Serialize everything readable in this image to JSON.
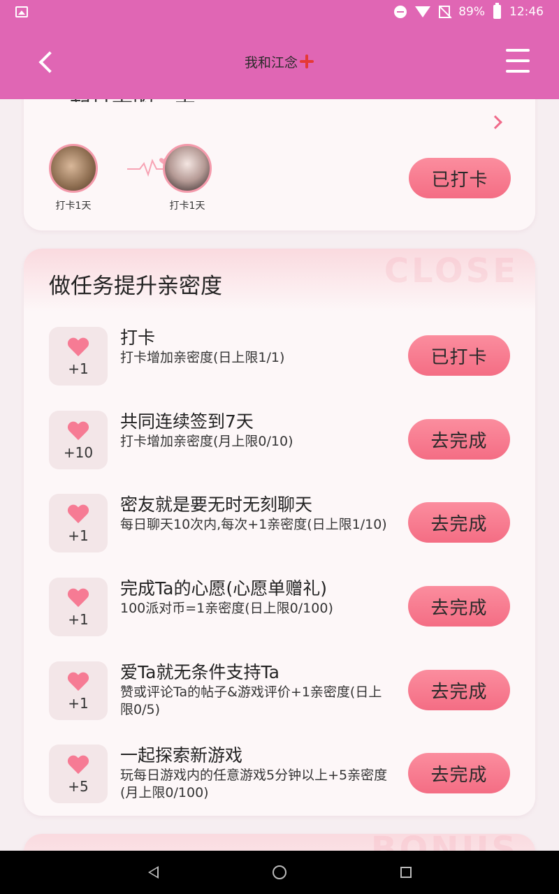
{
  "status_bar": {
    "battery": "89%",
    "time": "12:46"
  },
  "header": {
    "title": "我和江念"
  },
  "checkin": {
    "partial_title": "一起打卡的一天",
    "users": [
      {
        "label": "打卡1天"
      },
      {
        "label": "打卡1天"
      }
    ],
    "button_label": "已打卡"
  },
  "tasks_section": {
    "title": "做任务提升亲密度",
    "watermark": "CLOSE",
    "tasks": [
      {
        "points": "+1",
        "name": "打卡",
        "desc": "打卡增加亲密度(日上限1/1)",
        "button": "已打卡"
      },
      {
        "points": "+10",
        "name": "共同连续签到7天",
        "desc": "打卡增加亲密度(月上限0/10)",
        "button": "去完成"
      },
      {
        "points": "+1",
        "name": "密友就是要无时无刻聊天",
        "desc": "每日聊天10次内,每次+1亲密度(日上限1/10)",
        "button": "去完成"
      },
      {
        "points": "+1",
        "name": "完成Ta的心愿(心愿单赠礼)",
        "desc": "100派对币=1亲密度(日上限0/100)",
        "button": "去完成"
      },
      {
        "points": "+1",
        "name": "爱Ta就无条件支持Ta",
        "desc": "赞或评论Ta的帖子&游戏评价+1亲密度(日上限0/5)",
        "button": "去完成"
      },
      {
        "points": "+5",
        "name": "一起探索新游戏",
        "desc": "玩每日游戏内的任意游戏5分钟以上+5亲密度(月上限0/100)",
        "button": "去完成"
      }
    ]
  },
  "bottom_section": {
    "watermark": "BONUS"
  }
}
